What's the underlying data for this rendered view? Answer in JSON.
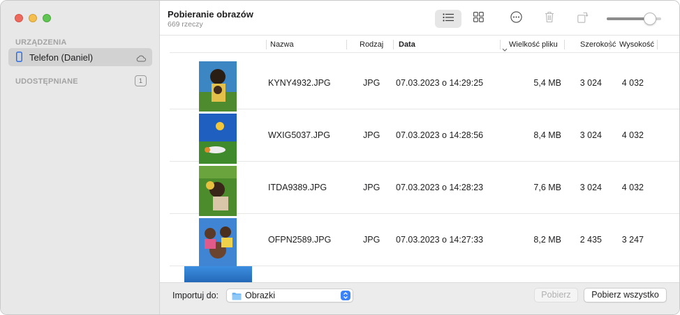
{
  "sidebar": {
    "devices_label": "URZĄDZENIA",
    "device_item": "Telefon (Daniel)",
    "shared_label": "UDOSTĘPNIANE",
    "shared_count": "1"
  },
  "toolbar": {
    "title": "Pobieranie obrazów",
    "subtitle": "669 rzeczy",
    "zoom_level": 0.88
  },
  "table": {
    "headers": {
      "name": "Nazwa",
      "kind": "Rodzaj",
      "date": "Data",
      "size": "Wielkość pliku",
      "width": "Szerokość",
      "height": "Wysokość"
    },
    "rows": [
      {
        "name": "KYNY4932.JPG",
        "kind": "JPG",
        "date": "07.03.2023 o 14:29:25",
        "size": "5,4 MB",
        "width": "3 024",
        "height": "4 032"
      },
      {
        "name": "WXIG5037.JPG",
        "kind": "JPG",
        "date": "07.03.2023 o 14:28:56",
        "size": "8,4 MB",
        "width": "3 024",
        "height": "4 032"
      },
      {
        "name": "ITDA9389.JPG",
        "kind": "JPG",
        "date": "07.03.2023 o 14:28:23",
        "size": "7,6 MB",
        "width": "3 024",
        "height": "4 032"
      },
      {
        "name": "OFPN2589.JPG",
        "kind": "JPG",
        "date": "07.03.2023 o 14:27:33",
        "size": "8,2 MB",
        "width": "2 435",
        "height": "3 247"
      }
    ]
  },
  "footer": {
    "import_label": "Importuj do:",
    "destination": "Obrazki",
    "download_button": "Pobierz",
    "download_all_button": "Pobierz wszystko"
  },
  "icons": {
    "list_view": "list-view-icon",
    "grid_view": "grid-view-icon",
    "more": "ellipsis-circle-icon",
    "delete": "trash-icon",
    "rotate": "rotate-icon",
    "device": "phone-icon",
    "cloud": "cloud-icon",
    "folder": "folder-icon"
  },
  "colors": {
    "accent": "#3a82f6",
    "sidebar_bg": "#e8e8e8",
    "selected_item": "#d2d2d2"
  }
}
